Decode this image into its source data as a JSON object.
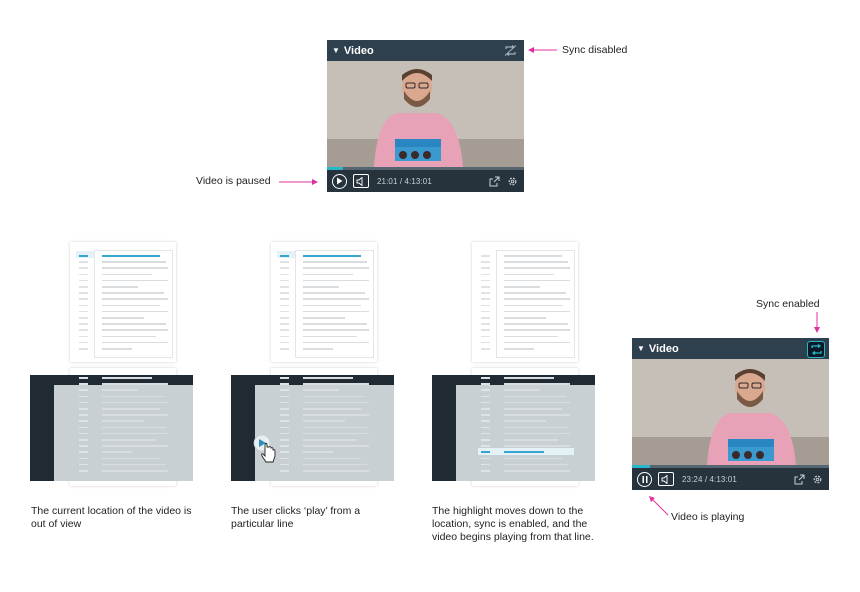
{
  "players": [
    {
      "id": "top",
      "title": "Video",
      "sync": "disabled",
      "time": "21:01 / 4:13:01",
      "state": "paused",
      "progress": 0.083
    },
    {
      "id": "right",
      "title": "Video",
      "sync": "enabled",
      "time": "23:24 / 4:13:01",
      "state": "playing",
      "progress": 0.092
    }
  ],
  "annotations": {
    "sync_disabled": "Sync disabled",
    "video_paused": "Video is paused",
    "sync_enabled": "Sync enabled",
    "video_playing": "Video is playing"
  },
  "steps": [
    {
      "caption": "The current location of the video is out of view"
    },
    {
      "caption": "The user clicks ‘play’ from a particular line"
    },
    {
      "caption": "The highlight moves down to the location, sync is enabled, and the video begins playing from that line."
    }
  ],
  "colors": {
    "accent": "#e0309f",
    "highlight": "#37a6cf",
    "player_bg": "#2e3f4d",
    "progress": "#27b7c9"
  },
  "icons": [
    "caret-down-icon",
    "sync-icon",
    "play-icon",
    "pause-icon",
    "volume-icon",
    "popout-icon",
    "gear-icon",
    "hand-cursor-icon"
  ]
}
